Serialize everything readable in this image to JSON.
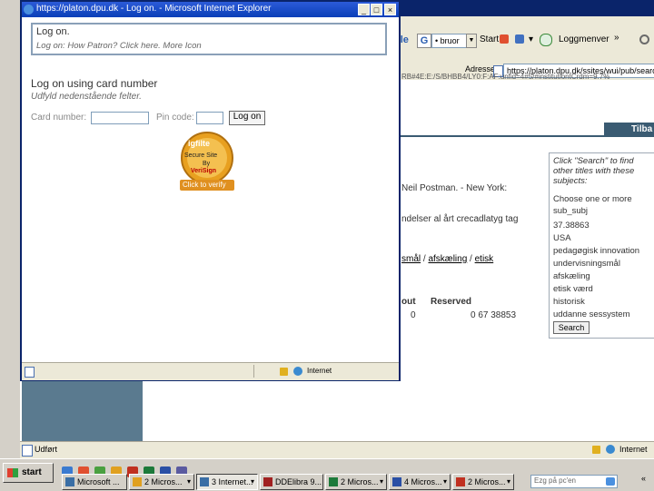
{
  "background_window": {
    "toolbar": {
      "search_dropdown": "• bruor",
      "search_button": "Start",
      "links_label": "Loggmenver",
      "more": "»"
    },
    "address_label": "Adresse",
    "address_url": "https://platon.dpu.dk/ssites/wui/pub/search",
    "url_fragment": "RB#4E:E:/S/BHBB4/LY0:F:AF:unfid=4#5/#institutiontCrdm=9.7%",
    "tab_label": "Tilba",
    "author_line": "Neil Postman. - New York:",
    "subject_line": "ndelser al årt crecadlatyg tag",
    "subject_links": [
      "smål",
      "afskæling",
      "etisk"
    ],
    "table_headers": [
      "out",
      "Reserved"
    ],
    "table_row": [
      "0",
      "0 67 38853"
    ],
    "sidebox": {
      "hint": [
        "Click \"Search\" to find",
        "other titles with these",
        "subjects:"
      ],
      "choose": "Choose one or more",
      "items": [
        "sub_subj",
        "37.38863",
        "USA",
        "pedagøgisk innovation",
        "undervisningsmål",
        "afskæling",
        "etisk værd",
        "historisk",
        "uddanne sessystem"
      ],
      "search_button": "Search"
    },
    "status": {
      "left": "Udført",
      "zone": "Internet"
    }
  },
  "popup": {
    "title": "https://platon.dpu.dk - Log on. - Microsoft Internet Explorer",
    "logon_title": "Log on.",
    "logon_subtitle": "Log on: How Patron? Click here. More Icon",
    "card_heading": "Log on using card number",
    "card_sub": "Udfyld nedenstående felter.",
    "card_number_label": "Card number:",
    "pin_label": "Pin code:",
    "logon_button": "Log on",
    "seal": {
      "brand": "igfilte",
      "line1": "Secure Site",
      "line2": "By",
      "line3": "VeriSign",
      "verify": "Click to verify"
    },
    "status_zone": "Internet"
  },
  "taskbar": {
    "start": "start",
    "tasks": [
      {
        "label": "Microsoft ...",
        "color": "#3a6ea5"
      },
      {
        "label": "2 Micros...",
        "color": "#e0a020",
        "arrow": true
      },
      {
        "label": "3 Internet...",
        "color": "#3a6ea5",
        "arrow": true,
        "active": true
      },
      {
        "label": "DDElibra 9...",
        "color": "#a02020"
      },
      {
        "label": "2 Micros...",
        "color": "#1d7a3a",
        "arrow": true
      },
      {
        "label": "4 Micros...",
        "color": "#2a4fa5",
        "arrow": true
      },
      {
        "label": "2 Micros...",
        "color": "#c03020",
        "arrow": true
      }
    ],
    "search_placeholder": "Ezg på pc'en",
    "clock": "«"
  }
}
